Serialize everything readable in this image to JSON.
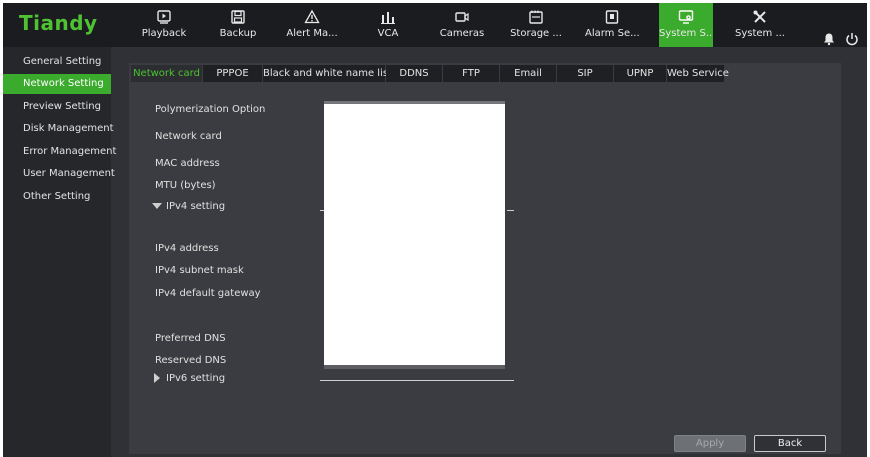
{
  "brand": {
    "logo_text": "Tiandy",
    "logo_color": "#4fc233",
    "accent": "#3bab2e"
  },
  "nav": [
    {
      "label": "Playback",
      "icon": "playback-icon"
    },
    {
      "label": "Backup",
      "icon": "backup-icon"
    },
    {
      "label": "Alert Ma...",
      "icon": "alert-icon"
    },
    {
      "label": "VCA",
      "icon": "vca-icon"
    },
    {
      "label": "Cameras",
      "icon": "camera-icon"
    },
    {
      "label": "Storage ...",
      "icon": "storage-icon"
    },
    {
      "label": "Alarm Se...",
      "icon": "alarm-icon"
    },
    {
      "label": "System S...",
      "icon": "system-settings-icon",
      "active": true
    },
    {
      "label": "System ...",
      "icon": "system-tools-icon"
    }
  ],
  "top_right": {
    "bell_icon": "bell-icon",
    "power_icon": "power-icon"
  },
  "sidebar": [
    {
      "label": "General Setting"
    },
    {
      "label": "Network Setting",
      "active": true
    },
    {
      "label": "Preview Setting"
    },
    {
      "label": "Disk Management"
    },
    {
      "label": "Error Management"
    },
    {
      "label": "User Management"
    },
    {
      "label": "Other Setting"
    }
  ],
  "tabs": [
    {
      "label": "Network card",
      "active": true
    },
    {
      "label": "PPPOE"
    },
    {
      "label": "Black and white name list"
    },
    {
      "label": "DDNS"
    },
    {
      "label": "FTP"
    },
    {
      "label": "Email"
    },
    {
      "label": "SIP"
    },
    {
      "label": "UPNP"
    },
    {
      "label": "Web Service"
    }
  ],
  "form": {
    "polymerization_option": "Polymerization Option",
    "network_card": "Network card",
    "mac_address": "MAC address",
    "mtu": "MTU (bytes)",
    "ipv4_setting": "IPv4 setting",
    "ipv4_address": "IPv4 address",
    "ipv4_subnet_mask": "IPv4 subnet mask",
    "ipv4_default_gateway": "IPv4 default gateway",
    "preferred_dns": "Preferred DNS",
    "reserved_dns": "Reserved DNS",
    "ipv6_setting": "IPv6 setting"
  },
  "buttons": {
    "apply": "Apply",
    "back": "Back"
  }
}
